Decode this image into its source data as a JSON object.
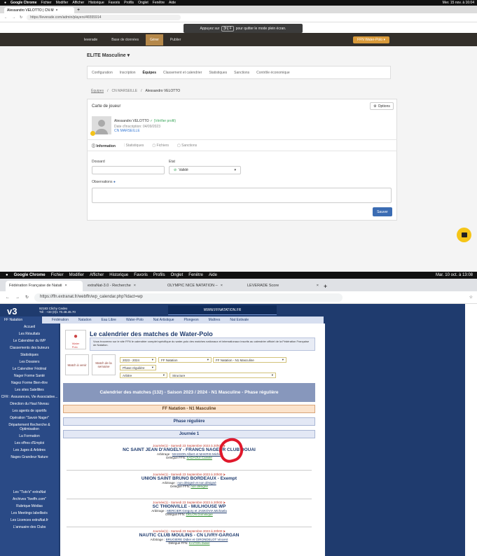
{
  "top_screen": {
    "menubar": {
      "items": [
        "Google Chrome",
        "Fichier",
        "Modifier",
        "Afficher",
        "Historique",
        "Favoris",
        "Profils",
        "Onglet",
        "Fenêtre",
        "Aide"
      ],
      "clock": "Mer. 15 nov. à 16:04"
    },
    "tab_title": "Alessandro VELOTTO | CN M",
    "url": "https://leverade.com/admin/players/46555914",
    "fullscreen_hint": {
      "before": "Appuyez sur",
      "key": "[fn] F",
      "after": "pour quitter le mode plein écran."
    },
    "app_nav": {
      "logo": "leverade",
      "items": [
        "Base de données",
        "Gérer",
        "Publier"
      ],
      "active": "Gérer",
      "team": "FFN Water-Polo ▾"
    },
    "competition": "ELITE Masculine ▾",
    "section_tabs": [
      "Configuration",
      "Inscription",
      "Équipes",
      "Classement et calendrier",
      "Statistiques",
      "Sanctions",
      "Contrôle économique"
    ],
    "active_section": "Équipes",
    "breadcrumb": [
      "Équipes",
      "CN MARSEILLE",
      "Alessandro VELOTTO"
    ],
    "card": {
      "title": "Carte de joueur",
      "options": "Options",
      "player_name": "Alessandro VELOTTO",
      "verified": "(Vérifier profil)",
      "registration_date": "Date d'inscription: 04/09/2023",
      "club": "CN MARSEILLE",
      "tabs": [
        "Information",
        "Statistiques",
        "Fichiers",
        "Sanctions"
      ],
      "fields": {
        "dossard_label": "Dossard",
        "etat_label": "Etat",
        "etat_value": "Validé",
        "observations_label": "Observations"
      },
      "save": "Sauver"
    }
  },
  "bottom_screen": {
    "menubar": {
      "items": [
        "Google Chrome",
        "Fichier",
        "Modifier",
        "Afficher",
        "Historique",
        "Favoris",
        "Profils",
        "Onglet",
        "Fenêtre",
        "Aide"
      ],
      "clock": "Mar. 10 oct. à 13:08"
    },
    "tabs": [
      "Fédération Française de Natati",
      "extraNat-3.0 - Recherche",
      "OLYMPIC NICE NATATION – ",
      "LEVERADE Score"
    ],
    "url": "https://ffn.extranat.fr/webffn/wp_calendar.php?idact=wp",
    "site": {
      "logo": "v3",
      "address": "92183 Clichy Cedex",
      "phone": "Tél : +33 (0)1 70.48.45.70",
      "www": "WWW.FFNATATION.FR",
      "topnav": [
        "FF Natation",
        "Fédération",
        "Natation",
        "Eau Libre",
        "Water-Polo",
        "Nat Artistique",
        "Plongeon",
        "Maîtres",
        "Nat Estivale"
      ],
      "sidebar": [
        "Accueil",
        "Les Résultats",
        "Le Calendrier du WP",
        "Classements des buteurs",
        "Statistiques",
        "Les Dossiers",
        "Le Calendrier Fédéral",
        "Nager Forme Santé",
        "Nagez Forme Bien-être",
        "Les sites Satellites",
        "CFR : Assurances, Vie Associative...",
        "Direction du Haut Niveau",
        "Les agents de sportifs",
        "Opération \"Savoir Nager\"",
        "Département Recherche & Optimisation",
        "La Formation",
        "Les offres d'Emploi",
        "Les Juges & Arbitres",
        "Nages Grandeur Nature",
        "Les \"Tuto's\" extraNat",
        "Archives \"liveffn.com\"",
        "Rubrique Médias",
        "Les Meetings labellisés",
        "Les Licences extraNat.fr",
        "L'annuaire des Clubs"
      ],
      "page_title": "Le calendrier des matches de Water-Polo",
      "intro": "Vous trouverez sur le site FFN le calendrier complet spécifique du water-polo des matches nationaux et internationaux inscrits au calendrier officiel de la Fédération Française de Natation.",
      "filters": {
        "box1": "Match à venir",
        "box2": "Match de la semaine",
        "season": "2023 - 2024",
        "org": "FF Natation",
        "competition": "FF Natation - N1 Masculine",
        "phase": "Phase régulière",
        "role": "Arbitre",
        "structure": "Structure"
      },
      "calendar_header": "Calendrier des matches (132) - Saison 2023 / 2024 - N1 Masculine - Phase régulière",
      "band1": "FF Natation - N1 Masculine",
      "band2": "Phase régulière",
      "band3": "Journée 1",
      "matches": [
        {
          "date": "Journée(1) - Samedi 23 Septembre 2023 à 20h00",
          "name": "NC SAINT JEAN D'ANGELY - FRANCS NAGEUR CLUB DOUAI",
          "ref_label": "Arbitrage :",
          "refs": "MASSON Albert et MAKRIS Michel",
          "del_label": "Délégué FFN:",
          "delegate": "SADAOUI Camille"
        },
        {
          "date": "Journée(1) - Samedi 23 Septembre 2023 à 20h00",
          "name": "UNION SAINT BRUNO BORDEAUX - Exempt",
          "ref_label": "Arbitrage :",
          "refs": "non désigné et non désigné",
          "del_label": "Délégué FFN:",
          "delegate": "non désigné"
        },
        {
          "date": "Journée(1) - Samedi 23 Septembre 2023 à 20h00",
          "name": "SC THIONVILLE - MULHOUSE WP",
          "ref_label": "Arbitrage :",
          "refs": "MERCIER Gregory et JASKOVIA Michaela",
          "del_label": "Délégué FFN:",
          "delegate": "DELON Dominique"
        },
        {
          "date": "Journée(1) - Samedi 23 Septembre 2023 à 20h00",
          "name": "NAUTIC CLUB MOULINS - CN LIVRY-GARGAN",
          "ref_label": "Arbitrage :",
          "refs": "BRUGIERE Didier et GIRONDELOT Vincent",
          "del_label": "Délégué FFN:",
          "delegate": "KAITON Didier"
        }
      ]
    }
  },
  "colors": {
    "accent": "#b5884a",
    "brand_blue": "#1f3b6e",
    "save": "#3b6cb3",
    "annotation": "#e0182b"
  }
}
